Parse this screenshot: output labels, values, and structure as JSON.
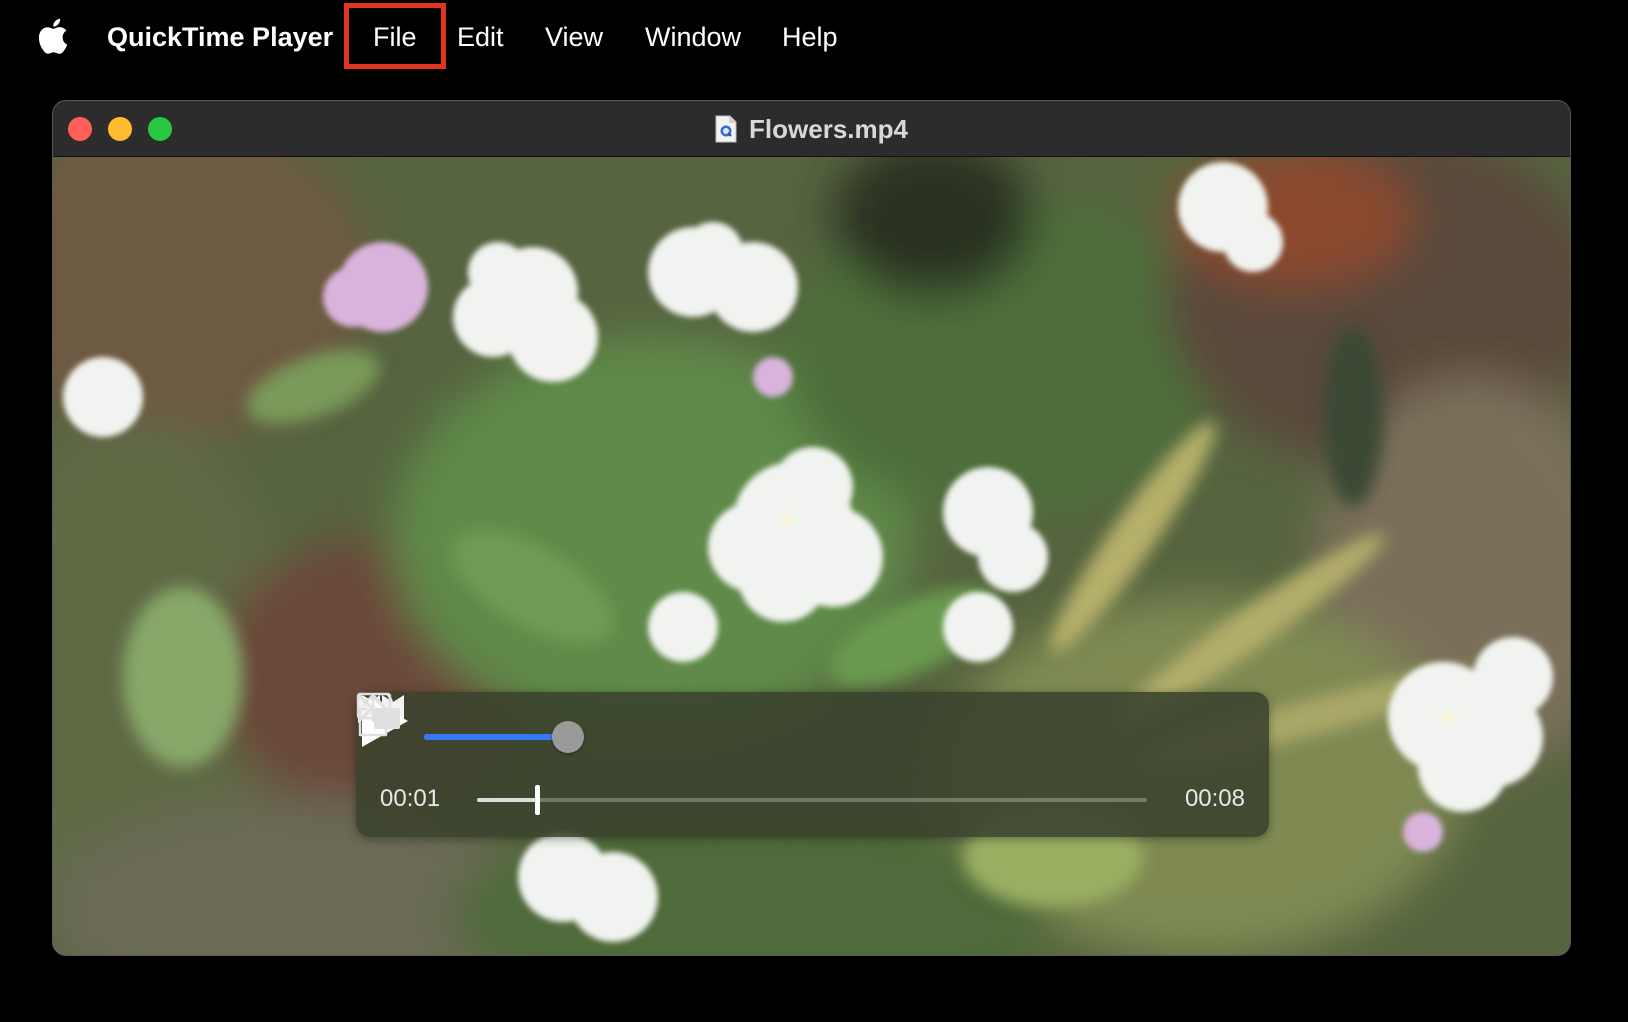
{
  "menubar": {
    "apple_icon": "apple-logo-icon",
    "app_name": "QuickTime Player",
    "items": [
      {
        "label": "File"
      },
      {
        "label": "Edit"
      },
      {
        "label": "View"
      },
      {
        "label": "Window"
      },
      {
        "label": "Help"
      }
    ],
    "highlight_color": "#e3341f"
  },
  "window": {
    "title": "Flowers.mp4",
    "title_icon": "quicktime-document-icon",
    "traffic_lights": {
      "close": "#ff5f57",
      "minimize": "#febc2e",
      "maximize": "#28c840"
    }
  },
  "video": {
    "content": "video-frame"
  },
  "controls": {
    "volume_icon": "speaker-volume-icon",
    "volume_level": 0.9,
    "rewind_icon": "rewind-icon",
    "play_icon": "play-icon",
    "fast_forward_icon": "fast-forward-icon",
    "pip_icon": "picture-in-picture-icon",
    "share_icon": "share-icon",
    "more_icon": "chevron-double-right-icon",
    "current_time": "00:01",
    "total_time": "00:08",
    "playback_progress": 0.09,
    "accent": "#3478f6"
  }
}
